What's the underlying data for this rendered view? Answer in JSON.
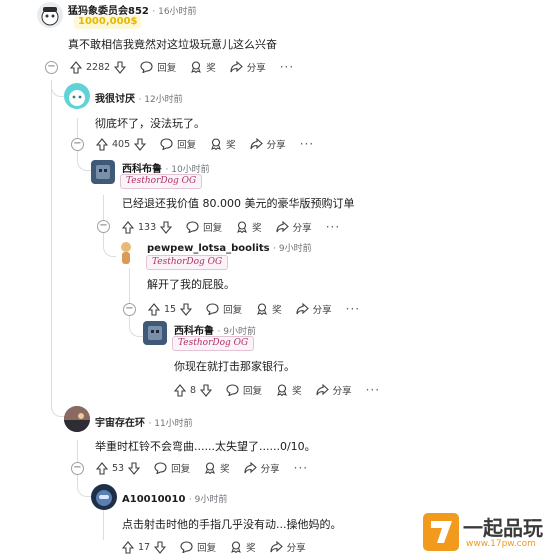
{
  "comments": [
    {
      "user": "猛犸象委员会852",
      "time": "16小时前",
      "badge": "1000,000$",
      "body": "真不敢相信我竟然对这垃圾玩意儿这么兴奋",
      "votes": "2282",
      "reply": "回复",
      "award": "奖",
      "share": "分享"
    },
    {
      "user": "我很讨厌",
      "time": "12小时前",
      "body": "彻底坏了，没法玩了。",
      "votes": "405",
      "reply": "回复",
      "award": "奖",
      "share": "分享"
    },
    {
      "user": "西科布鲁",
      "time": "10小时前",
      "flair": "TesthorDog OG",
      "body": "已经退还我价值 80.000 美元的豪华版预购订单",
      "votes": "133",
      "reply": "回复",
      "award": "奖",
      "share": "分享"
    },
    {
      "user": "pewpew_lotsa_boolits",
      "time": "9小时前",
      "flair": "TesthorDog OG",
      "body": "解开了我的屁股。",
      "votes": "15",
      "reply": "回复",
      "award": "奖",
      "share": "分享"
    },
    {
      "user": "西科布鲁",
      "time": "9小时前",
      "flair": "TesthorDog OG",
      "body": "你现在就打击那家银行。",
      "votes": "8",
      "reply": "回复",
      "award": "奖",
      "share": "分享"
    },
    {
      "user": "宇宙存在环",
      "time": "11小时前",
      "body": "举重时杠铃不会弯曲......太失望了......0/10。",
      "votes": "53",
      "reply": "回复",
      "award": "奖",
      "share": "分享"
    },
    {
      "user": "A10010010",
      "time": "9小时前",
      "body": "点击射击时他的手指几乎没有动...操他妈的。",
      "votes": "17",
      "reply": "回复",
      "award": "奖",
      "share": "分享"
    }
  ],
  "watermark": {
    "brand": "一起品玩",
    "url": "www.17pw.com"
  },
  "colors": {
    "flair": "#b0306a",
    "watermark": "#f29a1e",
    "line": "#dadde1"
  }
}
